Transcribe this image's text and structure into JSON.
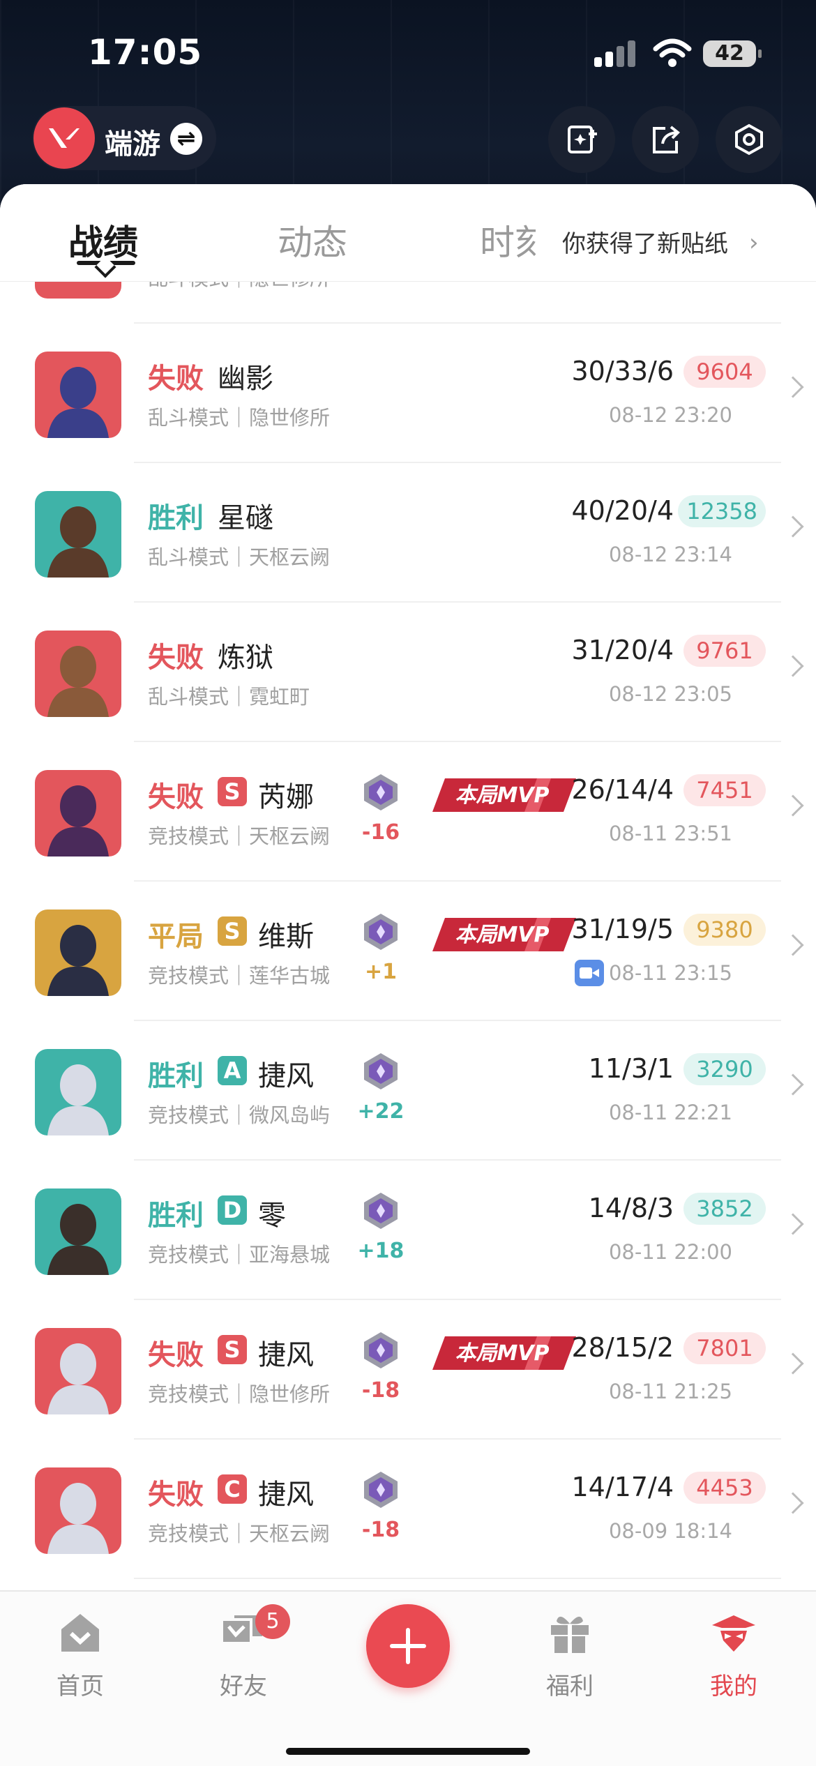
{
  "status_bar": {
    "time": "17:05",
    "battery": "42"
  },
  "brand": {
    "label": "端游",
    "switch_icon": "swap-icon"
  },
  "toolbar": {
    "icons": [
      "add-card-icon",
      "share-icon",
      "settings-icon"
    ]
  },
  "tabs": [
    {
      "label": "战绩",
      "active": true
    },
    {
      "label": "动态",
      "active": false
    },
    {
      "label": "时刻",
      "active": false
    }
  ],
  "sticker_notice": "你获得了新贴纸",
  "colors": {
    "loss": "#e3565c",
    "win": "#3fb3a8",
    "draw": "#d8a440",
    "accent": "#ea4a52"
  },
  "partial_row": {
    "text": "乱斗模式｜隐世修所"
  },
  "matches": [
    {
      "result": "失败",
      "tone": "red",
      "grade": "",
      "agent": "幽影",
      "mode": "乱斗模式｜隐世修所",
      "rank_change": "",
      "mvp": false,
      "mvp_label": "",
      "kda": "30/33/6",
      "score": "9604",
      "date": "08-12 23:20",
      "video": false,
      "avatar": {
        "bg": "#e3565c",
        "fg": "#3a3f8a"
      }
    },
    {
      "result": "胜利",
      "tone": "teal",
      "grade": "",
      "agent": "星礈",
      "mode": "乱斗模式｜天枢云阙",
      "rank_change": "",
      "mvp": false,
      "mvp_label": "",
      "kda": "40/20/4",
      "score": "12358",
      "date": "08-12 23:14",
      "video": false,
      "avatar": {
        "bg": "#3fb3a8",
        "fg": "#5a3b2a"
      }
    },
    {
      "result": "失败",
      "tone": "red",
      "grade": "",
      "agent": "炼狱",
      "mode": "乱斗模式｜霓虹町",
      "rank_change": "",
      "mvp": false,
      "mvp_label": "",
      "kda": "31/20/4",
      "score": "9761",
      "date": "08-12 23:05",
      "video": false,
      "avatar": {
        "bg": "#e3565c",
        "fg": "#8a5a3a"
      }
    },
    {
      "result": "失败",
      "tone": "red",
      "grade": "S",
      "agent": "芮娜",
      "mode": "竞技模式｜天枢云阙",
      "rank_change": "-16",
      "mvp": true,
      "mvp_label": "本局MVP",
      "kda": "26/14/4",
      "score": "7451",
      "date": "08-11 23:51",
      "video": false,
      "avatar": {
        "bg": "#e3565c",
        "fg": "#4a2a5a"
      }
    },
    {
      "result": "平局",
      "tone": "gold",
      "grade": "S",
      "agent": "维斯",
      "mode": "竞技模式｜莲华古城",
      "rank_change": "+1",
      "mvp": true,
      "mvp_label": "本局MVP",
      "kda": "31/19/5",
      "score": "9380",
      "date": "08-11 23:15",
      "video": true,
      "avatar": {
        "bg": "#d8a440",
        "fg": "#2a2e44"
      }
    },
    {
      "result": "胜利",
      "tone": "teal",
      "grade": "A",
      "agent": "捷风",
      "mode": "竞技模式｜微风岛屿",
      "rank_change": "+22",
      "mvp": false,
      "mvp_label": "",
      "kda": "11/3/1",
      "score": "3290",
      "date": "08-11 22:21",
      "video": false,
      "avatar": {
        "bg": "#3fb3a8",
        "fg": "#d8dbe6"
      }
    },
    {
      "result": "胜利",
      "tone": "teal",
      "grade": "D",
      "agent": "零",
      "mode": "竞技模式｜亚海悬城",
      "rank_change": "+18",
      "mvp": false,
      "mvp_label": "",
      "kda": "14/8/3",
      "score": "3852",
      "date": "08-11 22:00",
      "video": false,
      "avatar": {
        "bg": "#3fb3a8",
        "fg": "#3a2f2a"
      }
    },
    {
      "result": "失败",
      "tone": "red",
      "grade": "S",
      "agent": "捷风",
      "mode": "竞技模式｜隐世修所",
      "rank_change": "-18",
      "mvp": true,
      "mvp_label": "本局MVP",
      "kda": "28/15/2",
      "score": "7801",
      "date": "08-11 21:25",
      "video": false,
      "avatar": {
        "bg": "#e3565c",
        "fg": "#d8dbe6"
      }
    },
    {
      "result": "失败",
      "tone": "red",
      "grade": "C",
      "agent": "捷风",
      "mode": "竞技模式｜天枢云阙",
      "rank_change": "-18",
      "mvp": false,
      "mvp_label": "",
      "kda": "14/17/4",
      "score": "4453",
      "date": "08-09 18:14",
      "video": false,
      "avatar": {
        "bg": "#e3565c",
        "fg": "#d8dbe6"
      }
    }
  ],
  "nav": {
    "items": [
      {
        "label": "首页",
        "icon": "home-icon",
        "active": false
      },
      {
        "label": "好友",
        "icon": "friends-icon",
        "active": false,
        "badge": "5"
      },
      {
        "label": "",
        "icon": "plus-icon",
        "active": false
      },
      {
        "label": "福利",
        "icon": "gift-icon",
        "active": false
      },
      {
        "label": "我的",
        "icon": "profile-icon",
        "active": true
      }
    ]
  }
}
